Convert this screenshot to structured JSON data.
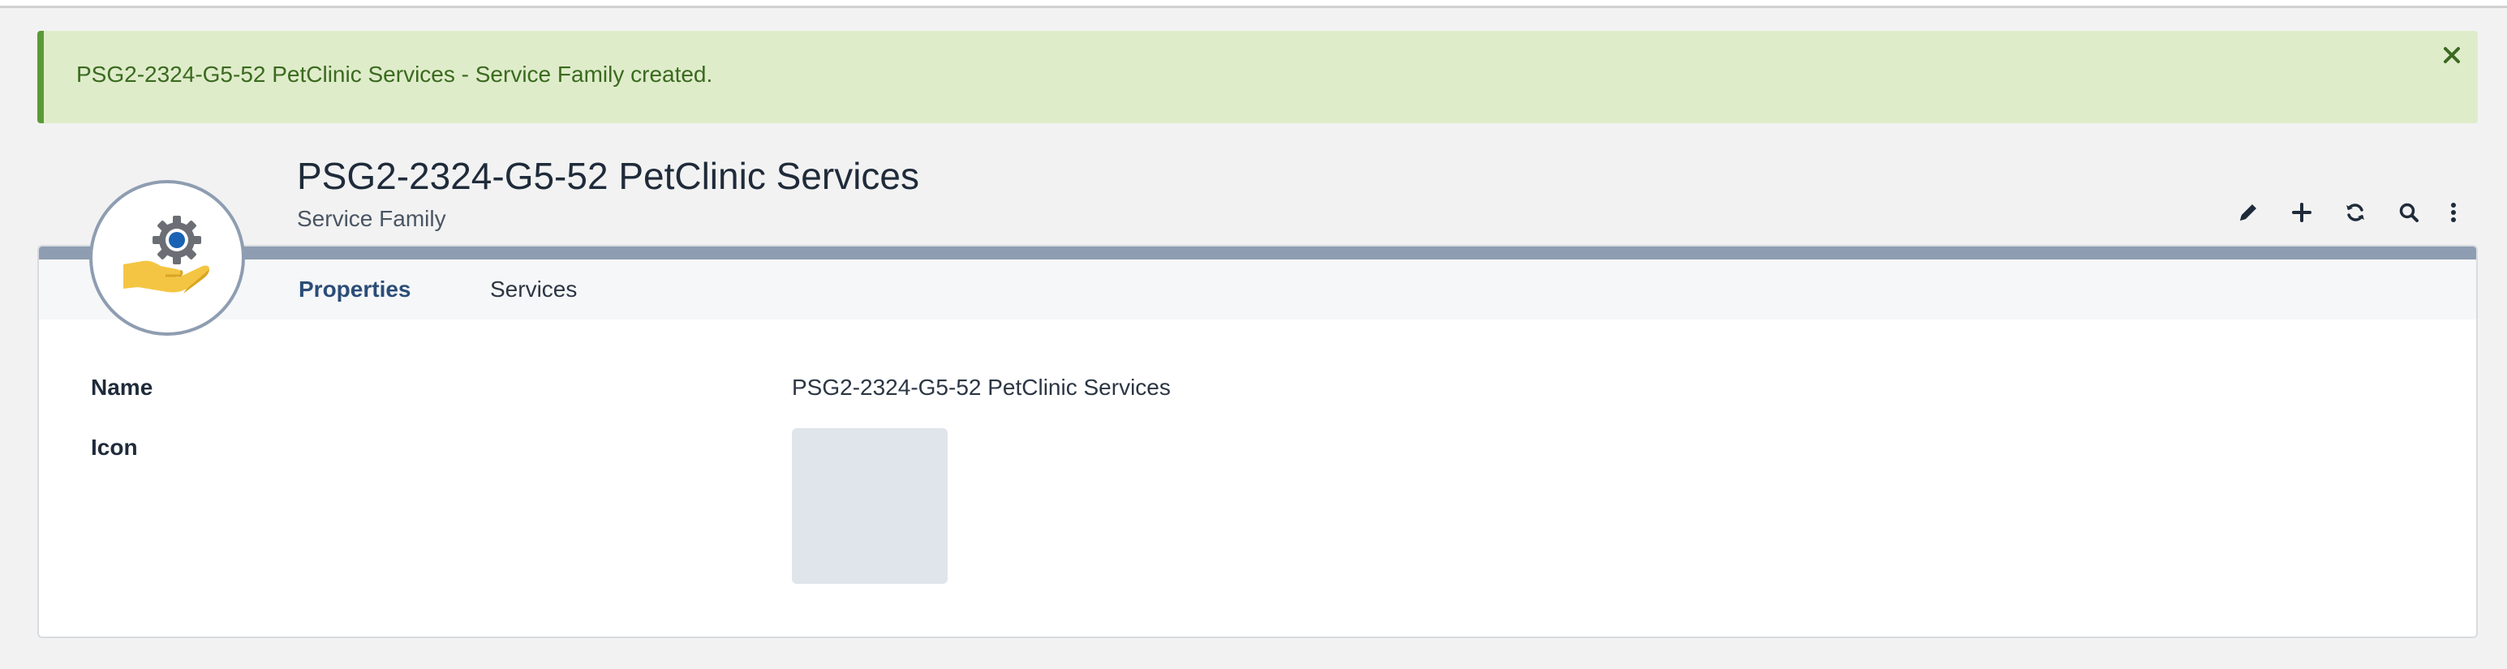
{
  "alert": {
    "message": "PSG2-2324-G5-52 PetClinic Services - Service Family created.",
    "close_glyph": "✕",
    "color": "#5a9a36"
  },
  "header": {
    "title": "PSG2-2324-G5-52 PetClinic Services",
    "subtitle": "Service Family",
    "avatar_icon": "service-family-icon"
  },
  "actions": [
    {
      "name": "edit",
      "icon": "pencil-icon"
    },
    {
      "name": "add",
      "icon": "plus-icon"
    },
    {
      "name": "refresh",
      "icon": "refresh-icon"
    },
    {
      "name": "search",
      "icon": "search-icon"
    },
    {
      "name": "more",
      "icon": "more-vertical-icon"
    }
  ],
  "tabs": [
    {
      "label": "Properties",
      "active": true
    },
    {
      "label": "Services",
      "active": false
    }
  ],
  "properties": {
    "name_label": "Name",
    "name_value": "PSG2-2324-G5-52 PetClinic Services",
    "icon_label": "Icon"
  },
  "colors": {
    "accent": "#2b4d78",
    "card_bar": "#8e9db1",
    "alert_bg": "#dfecca"
  }
}
